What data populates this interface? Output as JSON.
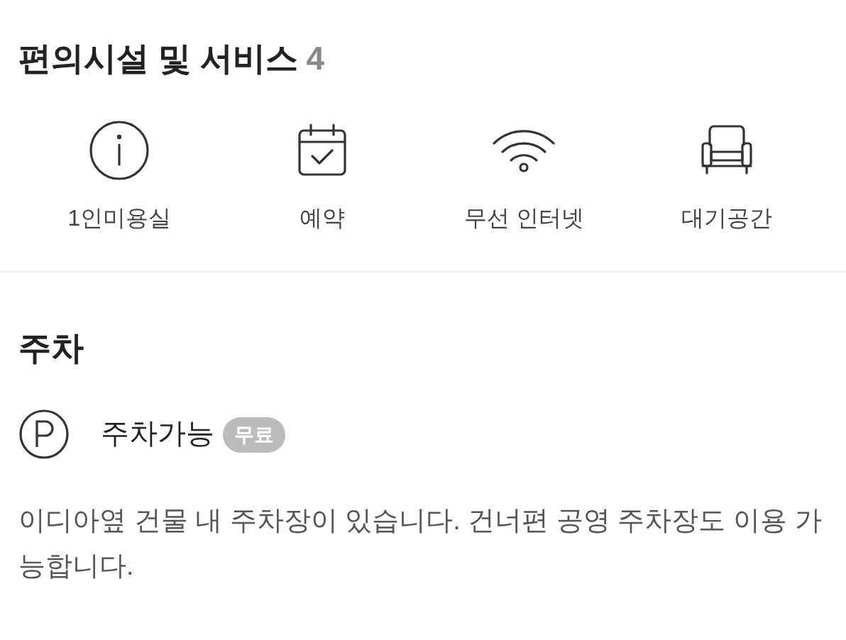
{
  "amenities": {
    "title": "편의시설 및 서비스",
    "count": "4",
    "items": [
      {
        "kind": "info",
        "label": "1인미용실"
      },
      {
        "kind": "calendar",
        "label": "예약"
      },
      {
        "kind": "wifi",
        "label": "무선 인터넷"
      },
      {
        "kind": "armchair",
        "label": "대기공간"
      }
    ]
  },
  "parking": {
    "title": "주차",
    "label": "주차가능",
    "badge": "무료",
    "description": "이디아옆 건물 내 주차장이 있습니다. 건너편 공영 주차장도 이용 가능합니다."
  }
}
